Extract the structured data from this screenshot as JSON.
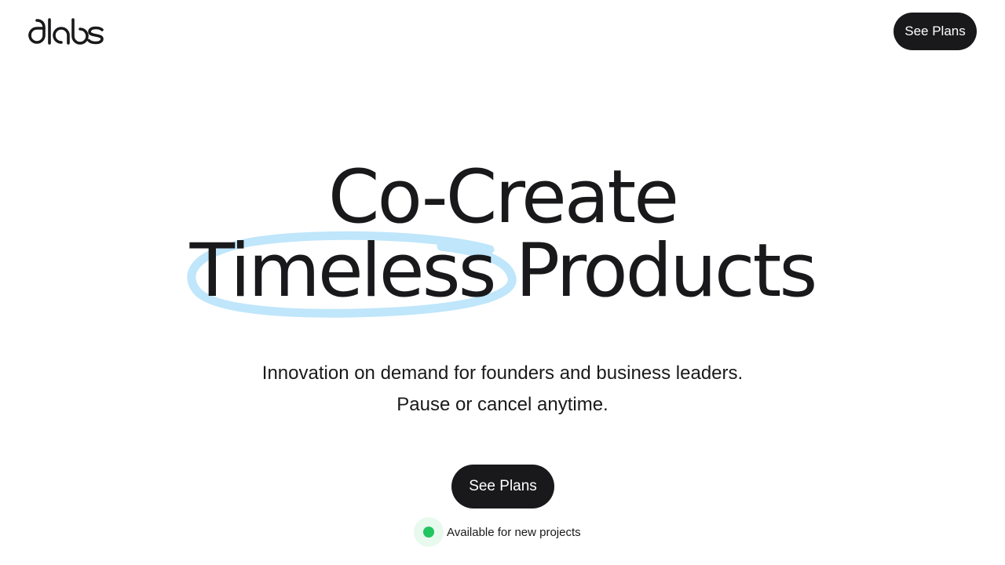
{
  "header": {
    "logo_text": "dlabs",
    "cta_label": "See Plans"
  },
  "hero": {
    "title_line1": "Co-Create",
    "title_line2": "Timeless Products",
    "subtitle_line1": "Innovation on demand for founders and business leaders.",
    "subtitle_line2": "Pause or cancel anytime.",
    "cta_label": "See Plans",
    "availability_text": "Available for new projects"
  },
  "colors": {
    "text": "#19191b",
    "background": "#ffffff",
    "button_bg": "#19191b",
    "button_text": "#ffffff",
    "scribble": "#bfe6fb",
    "status_dot": "#22c55e",
    "status_halo": "#e8f9ee"
  },
  "icons": {
    "scribble": "hand-drawn-circle",
    "status": "green-status-dot"
  }
}
